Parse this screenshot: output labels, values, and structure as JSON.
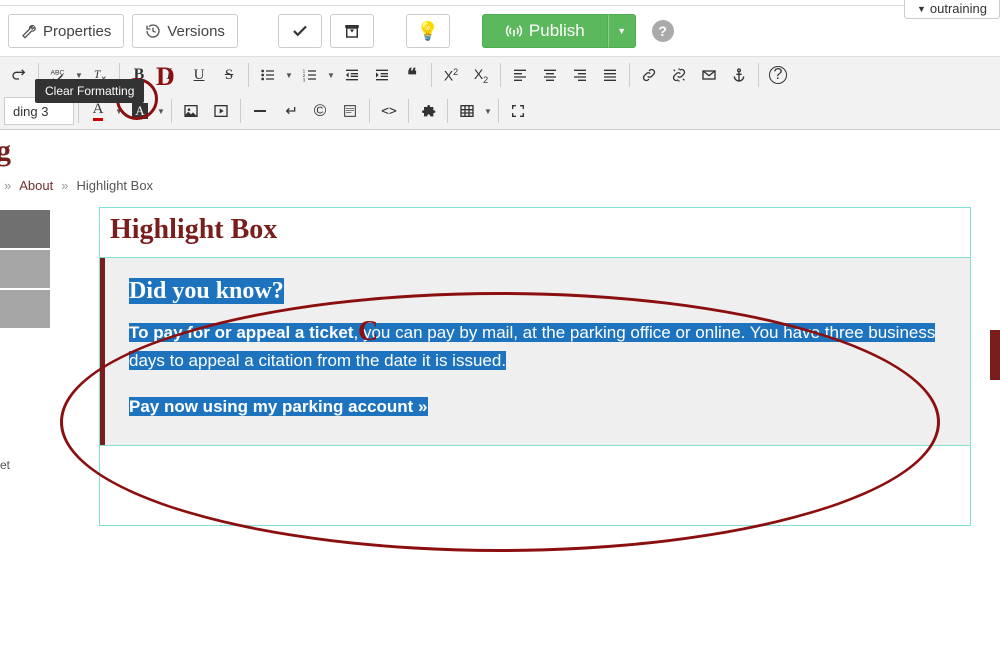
{
  "user": {
    "name": "outraining"
  },
  "cmdbar": {
    "properties": "Properties",
    "versions": "Versions",
    "publish": "Publish"
  },
  "toolbar": {
    "heading": "ding 3",
    "tooltip_clear_formatting": "Clear Formatting"
  },
  "page_title_frag": "g",
  "breadcrumb": {
    "about": "About",
    "current": "Highlight Box"
  },
  "sidebar": {
    "cutoff_label": "et"
  },
  "content": {
    "title": "Highlight Box",
    "box_heading": "Did you know?",
    "para_bold": "To pay for or appeal a ticket",
    "para_rest": ", you can pay by mail, at the parking office or online. You have three business days to appeal a citation from the date it is issued.",
    "link": "Pay now using my parking account »"
  },
  "annotations": {
    "D": "D",
    "C": "C"
  }
}
